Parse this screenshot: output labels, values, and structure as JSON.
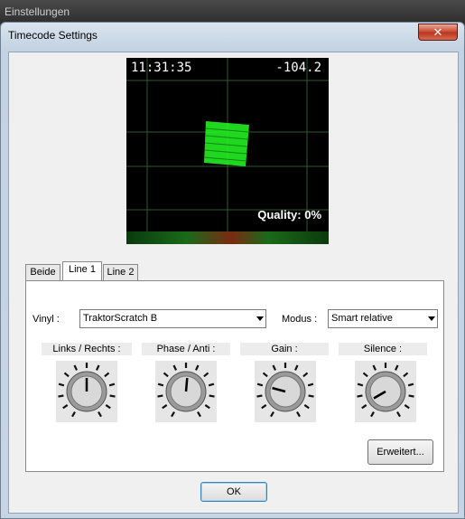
{
  "outer_window": {
    "title": "Einstellungen"
  },
  "dialog": {
    "title": "Timecode Settings",
    "close_glyph": "✕"
  },
  "scope": {
    "time": "11:31:35",
    "pitch": "-104.2",
    "quality": "Quality: 0%"
  },
  "tabs": [
    {
      "label": "Beide",
      "active": false
    },
    {
      "label": "Line 1",
      "active": true
    },
    {
      "label": "Line 2",
      "active": false
    }
  ],
  "vinyl": {
    "label": "Vinyl :",
    "value": "TraktorScratch B"
  },
  "modus": {
    "label": "Modus :",
    "value": "Smart relative"
  },
  "knobs": [
    {
      "label": "Links / Rechts :",
      "angle": 0
    },
    {
      "label": "Phase / Anti :",
      "angle": 5
    },
    {
      "label": "Gain :",
      "angle": -75
    },
    {
      "label": "Silence :",
      "angle": -120
    }
  ],
  "buttons": {
    "advanced": "Erweitert...",
    "ok": "OK"
  },
  "colors": {
    "scope_signal": "#22ee22",
    "close_button": "#c9462c"
  }
}
